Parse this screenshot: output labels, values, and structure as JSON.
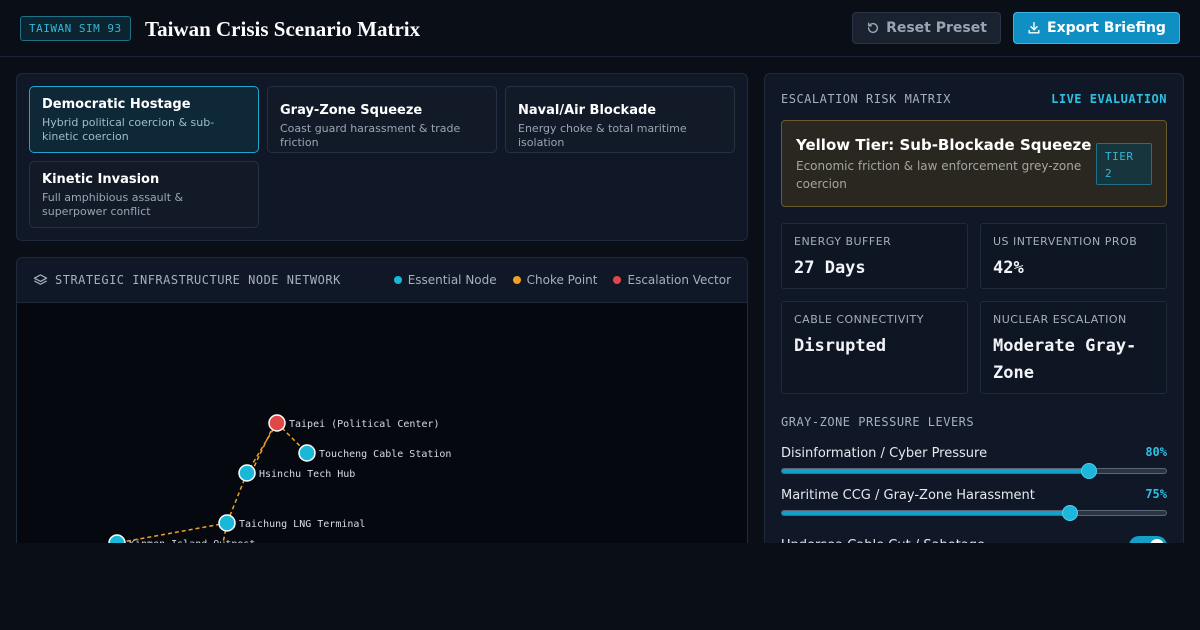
{
  "header": {
    "badge": "TAIWAN SIM 93",
    "title": "Taiwan Crisis Scenario Matrix",
    "reset_label": "Reset Preset",
    "export_label": "Export Briefing"
  },
  "scenarios": [
    {
      "title": "Democratic Hostage",
      "desc": "Hybrid political coercion & sub-kinetic coercion",
      "active": true
    },
    {
      "title": "Gray-Zone Squeeze",
      "desc": "Coast guard harassment & trade friction",
      "active": false
    },
    {
      "title": "Naval/Air Blockade",
      "desc": "Energy choke & total maritime isolation",
      "active": false
    },
    {
      "title": "Kinetic Invasion",
      "desc": "Full amphibious assault & superpower conflict",
      "active": false
    }
  ],
  "network": {
    "title": "STRATEGIC INFRASTRUCTURE NODE NETWORK",
    "legend": [
      {
        "label": "Essential Node",
        "color": "#1ab8d8"
      },
      {
        "label": "Choke Point",
        "color": "#f0a020"
      },
      {
        "label": "Escalation Vector",
        "color": "#e04848"
      }
    ],
    "nodes": [
      {
        "id": "taipei",
        "label": "Taipei (Political Center)",
        "color": "#e04848"
      },
      {
        "id": "toucheng",
        "label": "Toucheng Cable Station",
        "color": "#1ab8d8"
      },
      {
        "id": "hsinchu",
        "label": "Hsinchu Tech Hub",
        "color": "#1ab8d8"
      },
      {
        "id": "taichung",
        "label": "Taichung LNG Terminal",
        "color": "#1ab8d8"
      },
      {
        "id": "kinmen",
        "label": "Kinmen Island Outpost",
        "color": "#1ab8d8"
      }
    ]
  },
  "risk": {
    "title": "ESCALATION RISK MATRIX",
    "live_label": "LIVE EVALUATION",
    "tier_name": "Yellow Tier: Sub-Blockade Squeeze",
    "tier_desc": "Economic friction & law enforcement grey-zone coercion",
    "tier_badge": "TIER 2",
    "metrics": [
      {
        "label": "ENERGY BUFFER",
        "value": "27 Days"
      },
      {
        "label": "US INTERVENTION PROB",
        "value": "42%"
      },
      {
        "label": "CABLE CONNECTIVITY",
        "value": "Disrupted"
      },
      {
        "label": "NUCLEAR ESCALATION",
        "value": "Moderate Gray-Zone"
      }
    ],
    "levers_title": "GRAY-ZONE PRESSURE LEVERS",
    "levers": [
      {
        "label": "Disinformation / Cyber Pressure",
        "value": "80%",
        "level": 80
      },
      {
        "label": "Maritime CCG / Gray-Zone Harassment",
        "value": "75%",
        "level": 75
      }
    ],
    "toggle_label": "Undersea Cable Cut / Sabotage",
    "toggle_on": true
  }
}
